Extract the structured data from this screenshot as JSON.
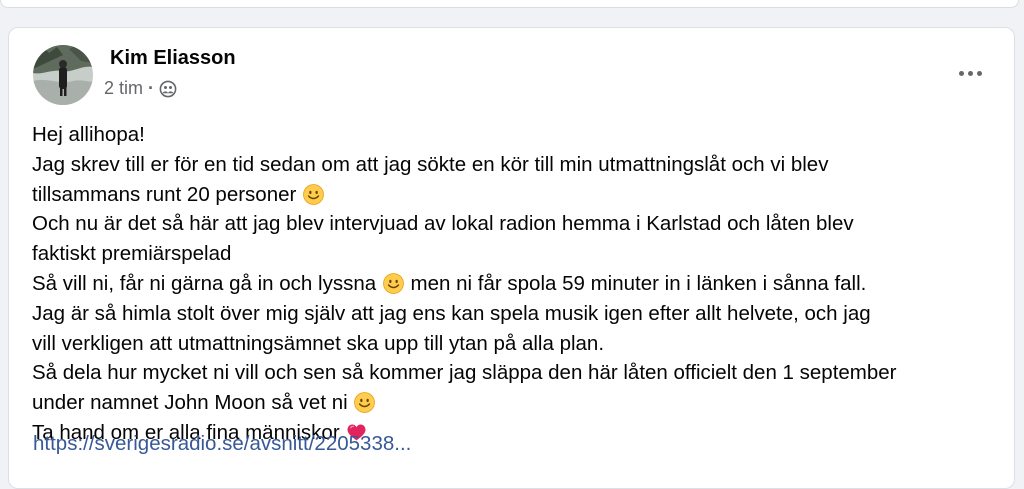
{
  "post": {
    "author": "Kim Eliasson",
    "time": "2 tim",
    "separator": "·",
    "audience_icon": "friends-icon",
    "menu_icon": "more-options-icon",
    "lines": [
      "Hej allihopa!",
      "Jag skrev till er för en tid sedan om att jag sökte en kör till min utmattningslåt och vi blev",
      "tillsammans runt 20 personer",
      "Och nu är det så här att jag blev intervjuad av lokal radion hemma i Karlstad och låten blev",
      "faktiskt premiärspelad",
      "Så vill ni, får ni gärna gå in och lyssna",
      "men ni får spola 59 minuter in i länken i sånna fall.",
      "Jag är så himla stolt över mig själv att jag ens kan spela musik igen efter allt helvete, och jag",
      "vill verkligen att utmattningsämnet ska upp till ytan på alla plan.",
      "Så dela hur mycket ni vill och sen så kommer jag släppa den här låten officielt den 1 september",
      "under namnet John Moon så vet ni",
      "Ta hand om er alla fina människor"
    ],
    "emoji": {
      "smile": "smiling-face-emoji",
      "heart": "red-heart-emoji"
    },
    "link": "https://sverigesradio.se/avsnitt/2205338..."
  },
  "colors": {
    "link": "#385898",
    "meta": "#65676b",
    "text": "#050505",
    "heart": "#e0245e"
  }
}
